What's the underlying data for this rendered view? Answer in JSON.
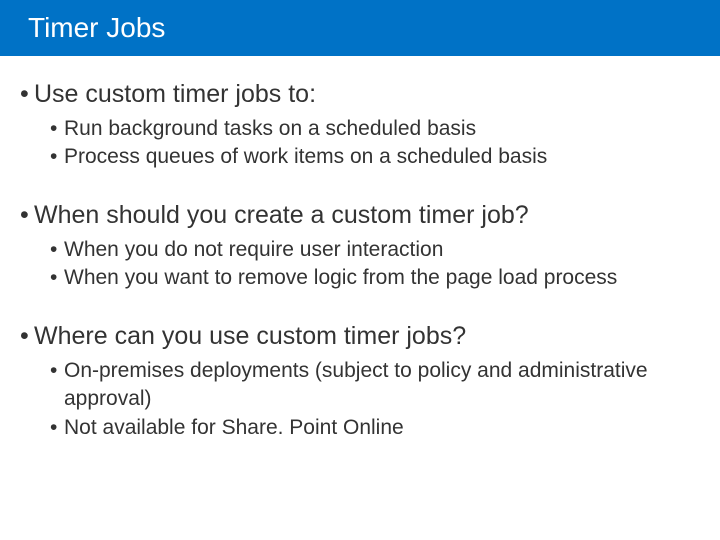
{
  "title": "Timer Jobs",
  "sections": [
    {
      "heading": "Use custom timer jobs to:",
      "items": [
        "Run background tasks on a scheduled basis",
        "Process queues of work items on a scheduled basis"
      ]
    },
    {
      "heading": "When should you create a custom timer job?",
      "items": [
        "When you do not require user interaction",
        "When you want to remove logic from the page load process"
      ]
    },
    {
      "heading": "Where can you use custom timer jobs?",
      "items": [
        "On-premises deployments (subject to policy and administrative approval)",
        "Not available for Share. Point Online"
      ]
    }
  ]
}
